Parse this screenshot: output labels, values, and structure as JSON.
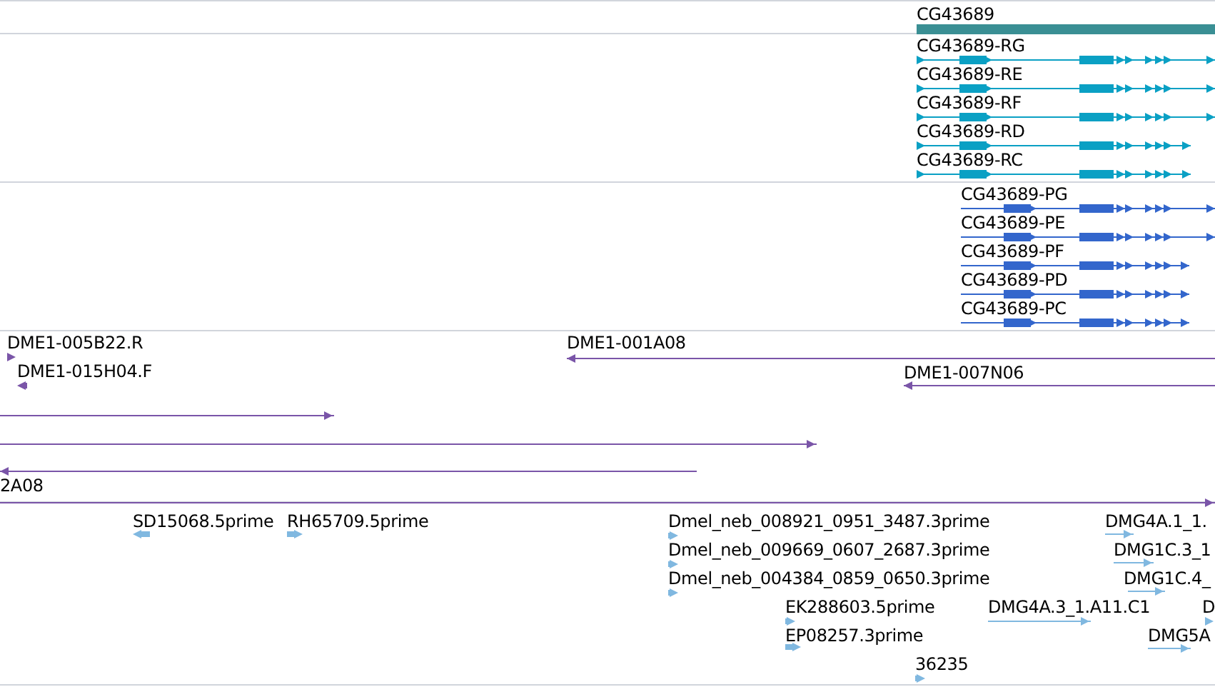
{
  "tracks": [
    {
      "kind": "gene",
      "features": [
        {
          "label": "CG43689"
        }
      ]
    },
    {
      "kind": "transcript",
      "features": [
        {
          "label": "CG43689-RG"
        },
        {
          "label": "CG43689-RE"
        },
        {
          "label": "CG43689-RF"
        },
        {
          "label": "CG43689-RD"
        },
        {
          "label": "CG43689-RC"
        }
      ]
    },
    {
      "kind": "protein",
      "features": [
        {
          "label": "CG43689-PG"
        },
        {
          "label": "CG43689-PE"
        },
        {
          "label": "CG43689-PF"
        },
        {
          "label": "CG43689-PD"
        },
        {
          "label": "CG43689-PC"
        }
      ]
    },
    {
      "kind": "clone",
      "features": [
        {
          "label": "DME1-005B22.R",
          "reverse": false
        },
        {
          "label": "DME1-015H04.F",
          "reverse": true
        },
        {
          "label": "DME1-001A08",
          "reverse": true
        },
        {
          "label": "DME1-007N06",
          "reverse": true
        },
        {
          "reverse": false
        },
        {
          "reverse": false
        },
        {
          "reverse": true
        },
        {
          "label": "2A08",
          "reverse": false
        }
      ]
    },
    {
      "kind": "est",
      "features": [
        {
          "label": "SD15068.5prime",
          "reverse": true
        },
        {
          "label": "RH65709.5prime",
          "reverse": false
        },
        {
          "label": "Dmel_neb_008921_0951_3487.3prime",
          "reverse": false
        },
        {
          "label": "Dmel_neb_009669_0607_2687.3prime",
          "reverse": false
        },
        {
          "label": "Dmel_neb_004384_0859_0650.3prime",
          "reverse": false
        },
        {
          "label": "EK288603.5prime",
          "reverse": false
        },
        {
          "label": "EP08257.3prime",
          "reverse": false
        },
        {
          "label": "36235",
          "reverse": false
        },
        {
          "label": "DMG4A.3_1.A11.C1",
          "reverse": false
        },
        {
          "label": "DMG4A.1_1.",
          "reverse": false
        },
        {
          "label": "DMG1C.3_1",
          "reverse": false
        },
        {
          "label": "DMG1C.4_",
          "reverse": false
        },
        {
          "label": "D",
          "reverse": false
        },
        {
          "label": "DMG5A",
          "reverse": false
        }
      ]
    }
  ]
}
